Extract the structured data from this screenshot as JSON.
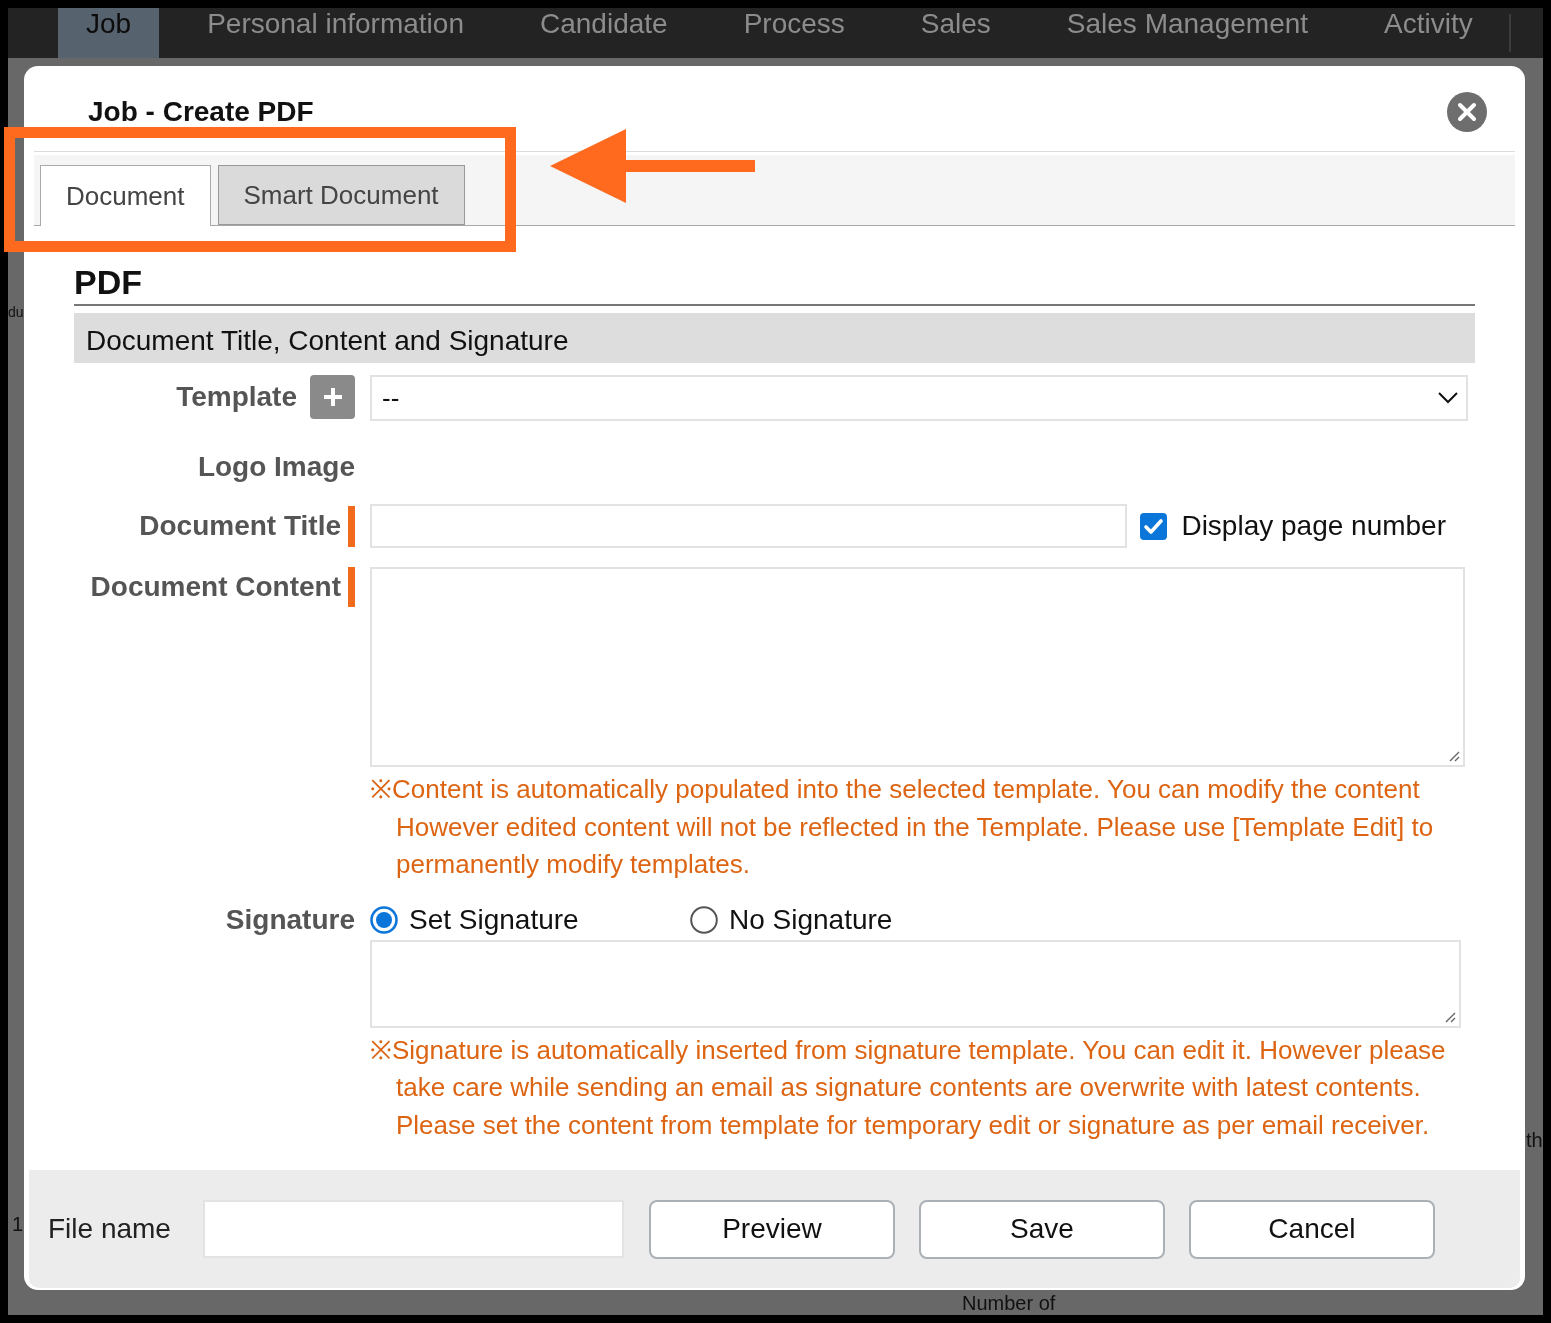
{
  "background_page": {
    "nav_tabs": [
      {
        "label": "Job",
        "selected": true
      },
      {
        "label": "Personal information",
        "selected": false
      },
      {
        "label": "Candidate",
        "selected": false
      },
      {
        "label": "Process",
        "selected": false
      },
      {
        "label": "Sales",
        "selected": false
      },
      {
        "label": "Sales Management",
        "selected": false
      },
      {
        "label": "Activity",
        "selected": false
      }
    ],
    "left_edge": [
      "du",
      "1"
    ],
    "right_edge": [
      "th"
    ],
    "bottom_edge": [
      "Number of"
    ]
  },
  "dialog": {
    "title": "Job - Create PDF",
    "tabs": [
      {
        "label": "Document",
        "selected": true
      },
      {
        "label": "Smart Document",
        "selected": false
      }
    ],
    "section": {
      "heading": "PDF",
      "subheading": "Document Title, Content and Signature"
    },
    "fields": [
      {
        "kind": "select",
        "label": "Template",
        "required": false,
        "value": "--"
      },
      {
        "kind": "empty",
        "label": "Logo Image",
        "required": false
      },
      {
        "kind": "text",
        "label": "Document Title",
        "required": true,
        "checkbox": {
          "label": "Display page number",
          "checked": true
        }
      },
      {
        "kind": "textarea",
        "label": "Document Content",
        "required": true,
        "note": [
          "※Content is automatically populated into the selected template. You can modify the content",
          "However edited content will not be reflected in the Template. Please use [Template Edit] to",
          "permanently modify templates."
        ]
      },
      {
        "kind": "radio_textarea",
        "label": "Signature",
        "required": false,
        "options": [
          {
            "label": "Set Signature",
            "selected": true
          },
          {
            "label": "No Signature",
            "selected": false
          }
        ],
        "note": [
          "※Signature is automatically inserted from signature template. You can edit it. However please",
          "take care while sending an email as signature contents are overwrite with latest contents.",
          "Please set the content from template for temporary edit or signature as per email receiver."
        ]
      }
    ],
    "footer": {
      "file_name_label": "File name",
      "buttons": [
        "Preview",
        "Save",
        "Cancel"
      ]
    }
  }
}
